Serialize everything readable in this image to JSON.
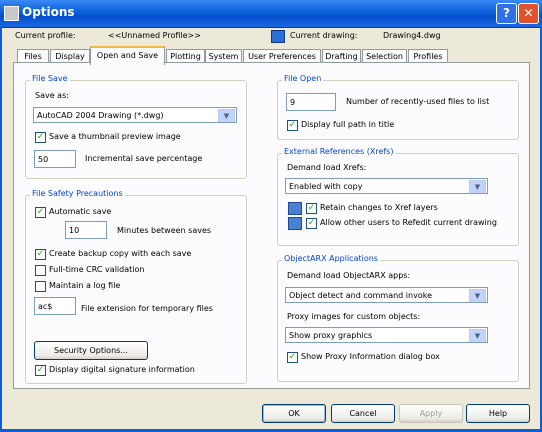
{
  "window": {
    "title": "Options",
    "help_glyph": "?",
    "close_glyph": "✕"
  },
  "header": {
    "current_profile_label": "Current profile:",
    "current_profile_value": "<<Unnamed Profile>>",
    "current_drawing_label": "Current drawing:",
    "current_drawing_value": "Drawing4.dwg"
  },
  "tabs": [
    "Files",
    "Display",
    "Open and Save",
    "Plotting",
    "System",
    "User Preferences",
    "Drafting",
    "Selection",
    "Profiles"
  ],
  "file_save": {
    "title": "File Save",
    "save_as_label": "Save as:",
    "save_as_value": "AutoCAD 2004 Drawing (*.dwg)",
    "thumbnail_label": "Save a thumbnail preview image",
    "thumbnail_checked": true,
    "incremental_value": "50",
    "incremental_label": "Incremental save percentage"
  },
  "file_safety": {
    "title": "File Safety Precautions",
    "autosave_label": "Automatic save",
    "autosave_checked": true,
    "minutes_value": "10",
    "minutes_label": "Minutes between saves",
    "backup_label": "Create backup copy with each save",
    "backup_checked": true,
    "crc_label": "Full-time CRC validation",
    "crc_checked": false,
    "log_label": "Maintain a log file",
    "log_checked": false,
    "ext_value": "ac$",
    "ext_label": "File extension for temporary files",
    "security_button": "Security Options...",
    "signature_label": "Display digital signature information",
    "signature_checked": true
  },
  "file_open": {
    "title": "File Open",
    "recent_value": "9",
    "recent_label": "Number of recently-used files to list",
    "fullpath_label": "Display full path in title",
    "fullpath_checked": true
  },
  "xrefs": {
    "title": "External References (Xrefs)",
    "demand_label": "Demand load Xrefs:",
    "demand_value": "Enabled with copy",
    "retain_label": "Retain changes to Xref layers",
    "retain_checked": true,
    "allow_label": "Allow other users to Refedit current drawing",
    "allow_checked": true
  },
  "objectarx": {
    "title": "ObjectARX Applications",
    "demand_label": "Demand load ObjectARX apps:",
    "demand_value": "Object detect and command invoke",
    "proxy_label": "Proxy images for custom objects:",
    "proxy_value": "Show proxy graphics",
    "proxy_dialog_label": "Show Proxy Information dialog box",
    "proxy_dialog_checked": true
  },
  "buttons": {
    "ok": "OK",
    "cancel": "Cancel",
    "apply": "Apply",
    "help": "Help"
  },
  "glyphs": {
    "check": "✓",
    "dropdown": "▼"
  }
}
